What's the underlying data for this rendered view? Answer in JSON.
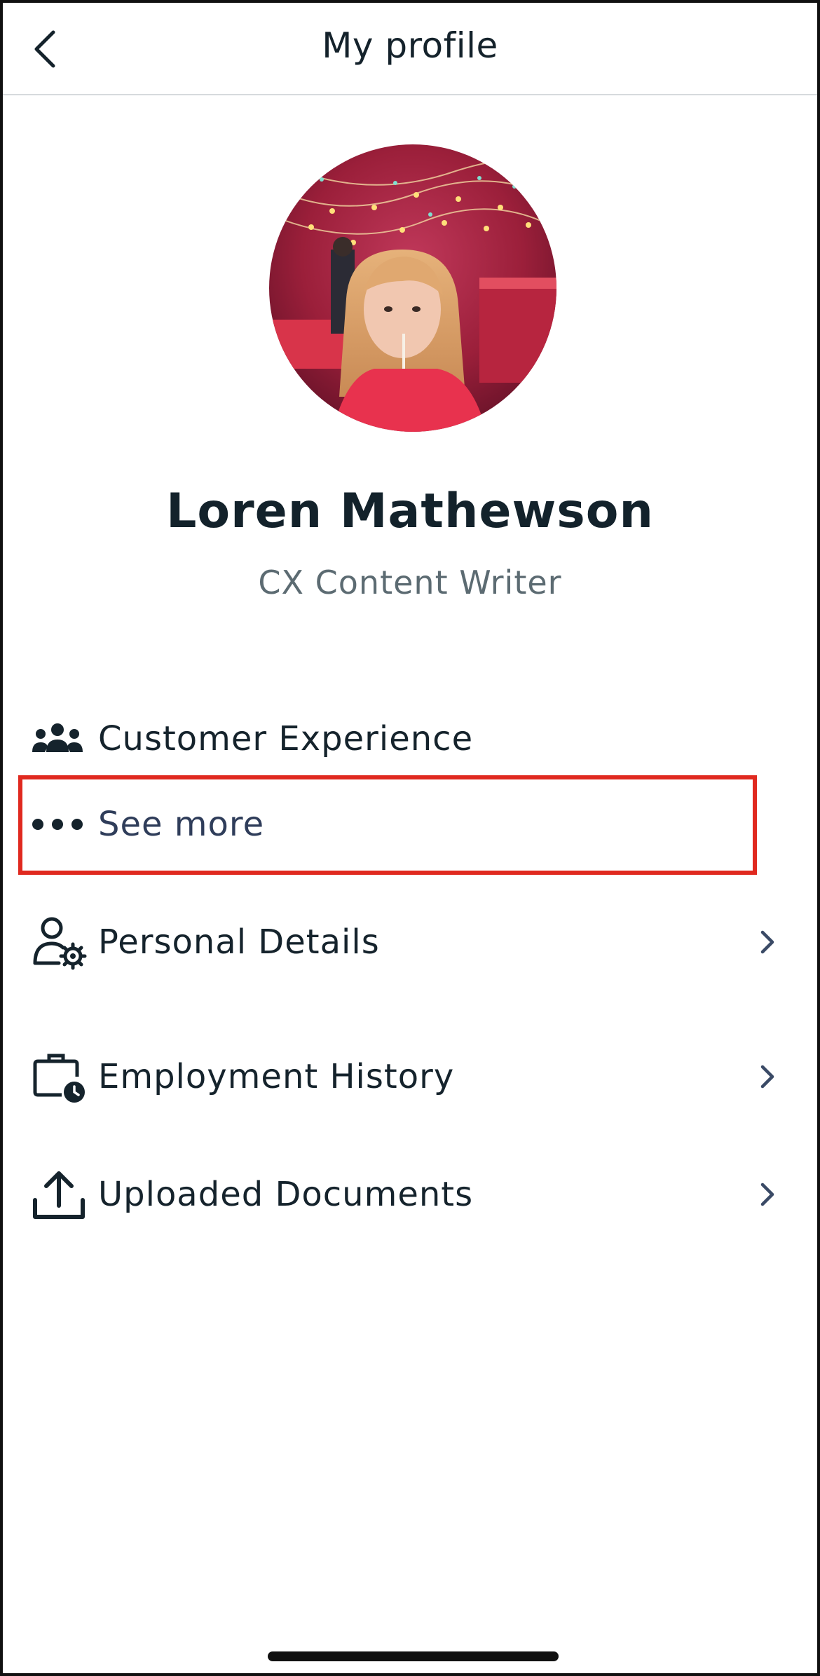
{
  "header": {
    "title": "My profile"
  },
  "profile": {
    "name": "Loren Mathewson",
    "role": "CX Content Writer"
  },
  "department": {
    "label": "Customer Experience"
  },
  "see_more": {
    "label": "See more"
  },
  "menu": {
    "items": [
      {
        "label": "Personal Details"
      },
      {
        "label": "Employment History"
      },
      {
        "label": "Uploaded Documents"
      }
    ]
  },
  "colors": {
    "text": "#15232c",
    "subtext": "#5c6b72",
    "highlight": "#e0291f",
    "icon": "#15232c",
    "chevron": "#3a4a66"
  },
  "icons": {
    "back": "chevron-left-icon",
    "department": "team-icon",
    "see_more": "more-horizontal-icon",
    "personal": "user-settings-icon",
    "employment": "briefcase-clock-icon",
    "documents": "upload-icon",
    "chevron": "chevron-right-icon"
  }
}
